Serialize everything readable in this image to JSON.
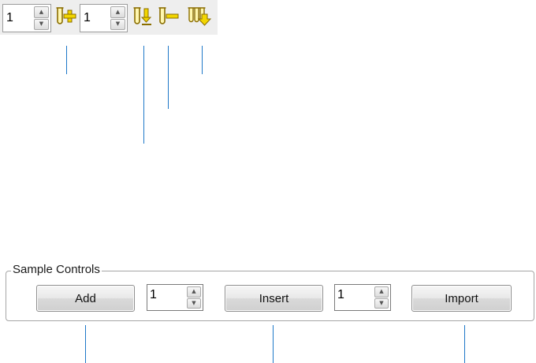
{
  "toolbar": {
    "count_1": {
      "value": "1",
      "up_glyph": "▲",
      "down_glyph": "▼"
    },
    "add_icon": "tube-add-icon",
    "count_2": {
      "value": "1",
      "up_glyph": "▲",
      "down_glyph": "▼"
    },
    "insert_icon": "tube-insert-icon",
    "remove_icon": "tube-remove-icon",
    "import_icon": "tubes-import-icon",
    "icon_colors": {
      "tube": "#8a6d00",
      "accent": "#f2d600"
    }
  },
  "sample_controls": {
    "title": "Sample Controls",
    "add_label": "Add",
    "add_count": {
      "value": "1",
      "up_glyph": "▲",
      "down_glyph": "▼"
    },
    "insert_label": "Insert",
    "insert_count": {
      "value": "1",
      "up_glyph": "▲",
      "down_glyph": "▼"
    },
    "import_label": "Import"
  },
  "callout_color": "#1e78c8"
}
